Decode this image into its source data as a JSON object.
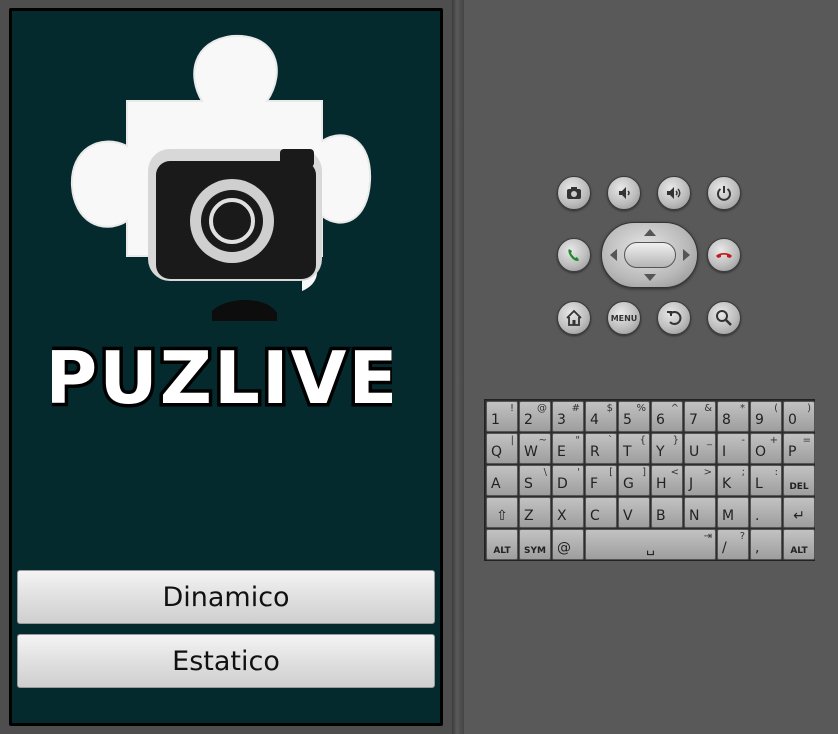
{
  "app": {
    "logo_text": "PUZLIVE",
    "buttons": {
      "dinamico": "Dinamico",
      "estatico": "Estatico"
    },
    "colors": {
      "screen_bg": "#052a2d",
      "button_text": "#111111"
    }
  },
  "controls": {
    "row1": [
      "camera-icon",
      "volume-down-icon",
      "volume-up-icon",
      "power-icon"
    ],
    "row2": [
      "call-icon",
      "dpad",
      "end-call-icon"
    ],
    "row3": [
      "home-icon",
      "menu",
      "back-icon",
      "search-icon"
    ],
    "menu_label": "MENU"
  },
  "keyboard": {
    "row1": [
      {
        "main": "1",
        "alt": "!"
      },
      {
        "main": "2",
        "alt": "@"
      },
      {
        "main": "3",
        "alt": "#"
      },
      {
        "main": "4",
        "alt": "$"
      },
      {
        "main": "5",
        "alt": "%"
      },
      {
        "main": "6",
        "alt": "^"
      },
      {
        "main": "7",
        "alt": "&"
      },
      {
        "main": "8",
        "alt": "*"
      },
      {
        "main": "9",
        "alt": "("
      },
      {
        "main": "0",
        "alt": ")"
      }
    ],
    "row2": [
      {
        "main": "Q",
        "alt": "|"
      },
      {
        "main": "W",
        "alt": "~"
      },
      {
        "main": "E",
        "alt": "\""
      },
      {
        "main": "R",
        "alt": "`"
      },
      {
        "main": "T",
        "alt": "{"
      },
      {
        "main": "Y",
        "alt": "}"
      },
      {
        "main": "U",
        "alt": "_"
      },
      {
        "main": "I",
        "alt": "-"
      },
      {
        "main": "O",
        "alt": "+"
      },
      {
        "main": "P",
        "alt": "="
      }
    ],
    "row3": [
      {
        "main": "A",
        "alt": ""
      },
      {
        "main": "S",
        "alt": "\\"
      },
      {
        "main": "D",
        "alt": "'"
      },
      {
        "main": "F",
        "alt": "["
      },
      {
        "main": "G",
        "alt": "]"
      },
      {
        "main": "H",
        "alt": "<"
      },
      {
        "main": "J",
        "alt": ">"
      },
      {
        "main": "K",
        "alt": ";"
      },
      {
        "main": "L",
        "alt": ":"
      },
      {
        "main": "DEL",
        "alt": ""
      }
    ],
    "row4": [
      {
        "main": "⇧",
        "alt": ""
      },
      {
        "main": "Z",
        "alt": ""
      },
      {
        "main": "X",
        "alt": ""
      },
      {
        "main": "C",
        "alt": ""
      },
      {
        "main": "V",
        "alt": ""
      },
      {
        "main": "B",
        "alt": ""
      },
      {
        "main": "N",
        "alt": ""
      },
      {
        "main": "M",
        "alt": ""
      },
      {
        "main": ".",
        "alt": ""
      },
      {
        "main": "↵",
        "alt": ""
      }
    ],
    "row5": [
      {
        "main": "ALT",
        "alt": ""
      },
      {
        "main": "SYM",
        "alt": ""
      },
      {
        "main": "@",
        "alt": ""
      },
      {
        "main": "␣",
        "alt": "⇥"
      },
      {
        "main": "/",
        "alt": "?"
      },
      {
        "main": ",",
        "alt": ""
      },
      {
        "main": "ALT",
        "alt": ""
      }
    ]
  }
}
